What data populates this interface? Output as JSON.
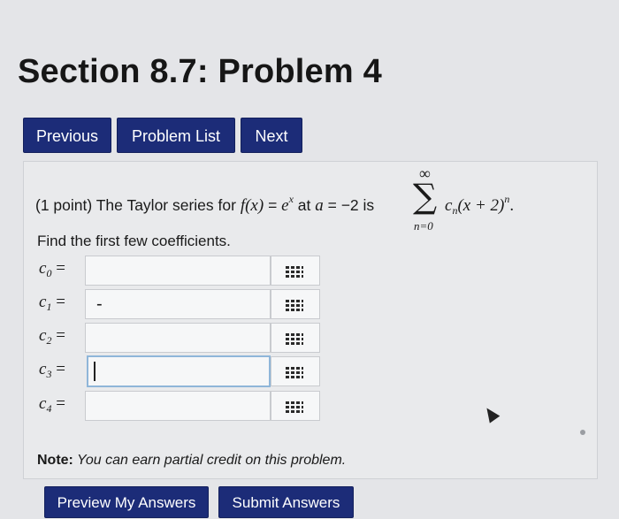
{
  "page_title": "Section 8.7: Problem 4",
  "nav": {
    "previous": "Previous",
    "problem_list": "Problem List",
    "next": "Next"
  },
  "problem": {
    "points": "(1 point) The Taylor series for",
    "fx": "f(x)",
    "eq1": " = ",
    "exp_base": "e",
    "exp_power": "x",
    "at_text": " at ",
    "a_var": "a",
    "eq2": " = −2 is ",
    "sigma_upper": "∞",
    "sigma_glyph": "∑",
    "sigma_lower": "n=0",
    "term_c": "c",
    "term_c_sub": "n",
    "term_rest": "(x + 2)",
    "term_power": "n",
    "term_end": "."
  },
  "instruction": "Find the first few coefficients.",
  "coefficients": [
    {
      "label": "c",
      "sub": "0",
      "eq": "=",
      "value": ""
    },
    {
      "label": "c",
      "sub": "1",
      "eq": "=",
      "value": "-"
    },
    {
      "label": "c",
      "sub": "2",
      "eq": "=",
      "value": ""
    },
    {
      "label": "c",
      "sub": "3",
      "eq": "=",
      "value": ""
    },
    {
      "label": "c",
      "sub": "4",
      "eq": "=",
      "value": ""
    }
  ],
  "note": {
    "prefix": "Note:",
    "text": " You can earn partial credit on this problem."
  },
  "actions": {
    "preview": "Preview My Answers",
    "submit": "Submit Answers"
  },
  "icons": {
    "equation_editor": "grid-icon",
    "pointer": "mouse-pointer-icon"
  },
  "colors": {
    "button_bg": "#1c2c78",
    "active_field_border": "#8fb6d9"
  }
}
